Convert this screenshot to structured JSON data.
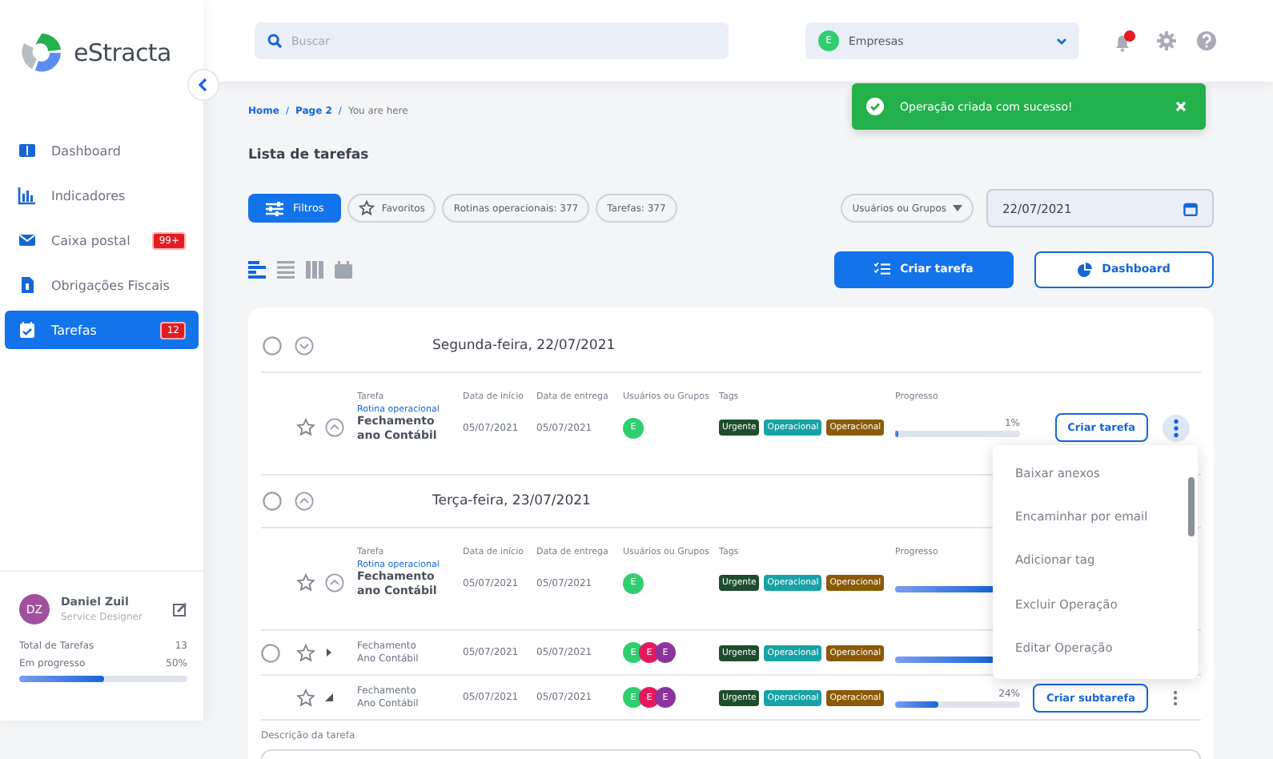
{
  "sidebar": {
    "brand": "eStracta",
    "items": [
      {
        "label": "Dashboard",
        "selected": false
      },
      {
        "label": "Indicadores",
        "selected": false
      },
      {
        "label": "Caixa postal",
        "badge": "99+",
        "selected": false
      },
      {
        "label": "Obrigações Fiscais",
        "selected": false
      },
      {
        "label": "Tarefas",
        "badge": "12",
        "selected": true
      }
    ],
    "user": {
      "initials": "DZ",
      "name": "Daniel Zuil",
      "role": "Service Designer"
    },
    "stats": [
      {
        "label": "Total de Tarefas",
        "value": "13"
      },
      {
        "label": "Em progresso",
        "value": "50%"
      }
    ],
    "progress": {
      "level": 0.5
    }
  },
  "topbar": {
    "search": {
      "placeholder": "Buscar"
    },
    "company": {
      "initial": "E",
      "label": "Empresas"
    }
  },
  "toast": {
    "message": "Operação criada com sucesso!"
  },
  "breadcrumb": [
    {
      "label": "Home",
      "kind": "link"
    },
    {
      "label": "/",
      "kind": "separator"
    },
    {
      "label": "Page 2",
      "kind": "link"
    },
    {
      "label": "/",
      "kind": "separator"
    },
    {
      "label": "You are here",
      "kind": "current"
    }
  ],
  "page_title": "Lista de tarefas",
  "filters": {
    "button": "Filtros",
    "chips": [
      {
        "label": "Favoritos",
        "kind": "favorite"
      },
      {
        "label": "Rotinas operacionais: 377",
        "kind": "plain"
      },
      {
        "label": "Tarefas: 377",
        "kind": "plain"
      }
    ],
    "users_dropdown": "Usuários ou Grupos",
    "date": "22/07/2021"
  },
  "views": [
    {
      "selected": true
    },
    {
      "selected": false
    },
    {
      "selected": false
    },
    {
      "selected": false
    }
  ],
  "actions": [
    {
      "label": "Criar tarefa",
      "kind": "primary"
    },
    {
      "label": "Dashboard",
      "kind": "outline"
    }
  ],
  "groups": [
    {
      "date": "Segunda-feira, 22/07/2021",
      "checked": false,
      "expanded": false,
      "rows": [
        {
          "kind": "task",
          "expanded": true,
          "labels": [
            "Tarefa",
            "Data de início",
            "Data de entrega",
            "Usuários ou Grupos",
            "Tags",
            "Progresso"
          ],
          "category": "Rotina operacional",
          "name": "Fechamento ano Contábil",
          "start": "05/07/2021",
          "end": "05/07/2021",
          "users": [
            {
              "initial": "E",
              "color": "#2fce6f"
            }
          ],
          "tags": [
            {
              "label": "Urgente",
              "color": "#1d4d2c"
            },
            {
              "label": "Operacional",
              "color": "#17a2a6"
            },
            {
              "label": "Operacional",
              "color": "#8a5a06"
            }
          ],
          "level": 0.01,
          "percent": "1%",
          "action": "Criar tarefa",
          "more": {
            "open": true
          }
        }
      ]
    },
    {
      "date": "Terça-feira, 23/07/2021",
      "checked": false,
      "expanded": true,
      "rows": [
        {
          "kind": "task",
          "expanded": true,
          "labels": [
            "Tarefa",
            "Data de início",
            "Data de entrega",
            "Usuários ou Grupos",
            "Tags",
            "Progresso"
          ],
          "category": "Rotina operacional",
          "name": "Fechamento ano Contábil",
          "start": "05/07/2021",
          "end": "05/07/2021",
          "users": [
            {
              "initial": "E",
              "color": "#2fce6f"
            }
          ],
          "tags": [
            {
              "label": "Urgente",
              "color": "#1d4d2c"
            },
            {
              "label": "Operacional",
              "color": "#17a2a6"
            },
            {
              "label": "Operacional",
              "color": "#8a5a06"
            }
          ],
          "level": 0.8
        },
        {
          "kind": "subtask",
          "checked": false,
          "expanded": false,
          "name": "Fechamento Ano Contábil",
          "start": "05/07/2021",
          "end": "05/07/2021",
          "users": [
            {
              "initial": "E",
              "color": "#2fce6f"
            },
            {
              "initial": "E",
              "color": "#e5195e"
            },
            {
              "initial": "E",
              "color": "#8a349c"
            }
          ],
          "tags": [
            {
              "label": "Urgente",
              "color": "#1d4d2c"
            },
            {
              "label": "Operacional",
              "color": "#17a2a6"
            },
            {
              "label": "Operacional",
              "color": "#8a5a06"
            }
          ],
          "level": 0.8
        },
        {
          "kind": "subtask",
          "expanded": true,
          "name": "Fechamento Ano Contábil",
          "start": "05/07/2021",
          "end": "05/07/2021",
          "users": [
            {
              "initial": "E",
              "color": "#2fce6f"
            },
            {
              "initial": "E",
              "color": "#e5195e"
            },
            {
              "initial": "E",
              "color": "#8a349c"
            }
          ],
          "tags": [
            {
              "label": "Urgente",
              "color": "#1d4d2c"
            },
            {
              "label": "Operacional",
              "color": "#17a2a6"
            },
            {
              "label": "Operacional",
              "color": "#8a5a06"
            }
          ],
          "level": 0.35,
          "percent": "24%",
          "action": "Criar subtarefa",
          "more": {
            "open": false
          }
        }
      ]
    }
  ],
  "description_label": "Descrição da tarefa",
  "context_menu": {
    "items": [
      "Baixar anexos",
      "Encaminhar por email",
      "Adicionar tag",
      "Excluir Operação",
      "Editar Operação"
    ]
  }
}
